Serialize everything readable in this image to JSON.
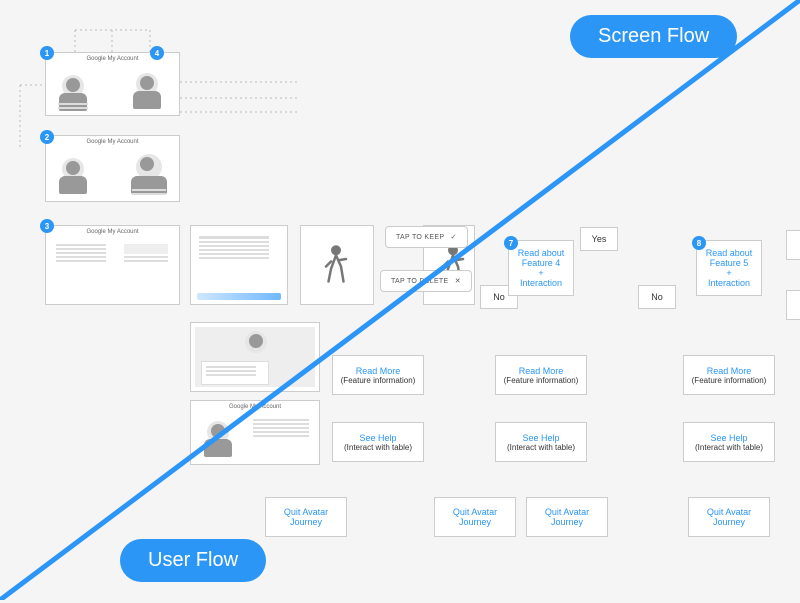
{
  "labels": {
    "screen_flow": "Screen Flow",
    "user_flow": "User Flow"
  },
  "badges": {
    "b1": "1",
    "b2": "2",
    "b3": "3",
    "b4": "4",
    "b7": "7",
    "b8": "8"
  },
  "taps": {
    "keep": "TAP TO KEEP",
    "delete": "TAP TO DELETE"
  },
  "decision": {
    "yes": "Yes",
    "no": "No"
  },
  "feature_nodes": {
    "f4": {
      "line1": "Read about",
      "line2": "Feature 4",
      "plus": "+",
      "line3": "Interaction"
    },
    "f5": {
      "line1": "Read about",
      "line2": "Feature 5",
      "plus": "+",
      "line3": "Interaction"
    }
  },
  "read_more": {
    "title": "Read More",
    "sub": "(Feature information)"
  },
  "see_help": {
    "title": "See Help",
    "sub": "(Interact with table)"
  },
  "quit": {
    "line1": "Quit Avatar",
    "line2": "Journey"
  },
  "columns": [
    "c1",
    "c2",
    "c3",
    "c4"
  ],
  "screen_titles": {
    "s1": "Google My Account",
    "s2": "Google My Account",
    "s3": "Google My Account",
    "low2": "Google My Account"
  }
}
